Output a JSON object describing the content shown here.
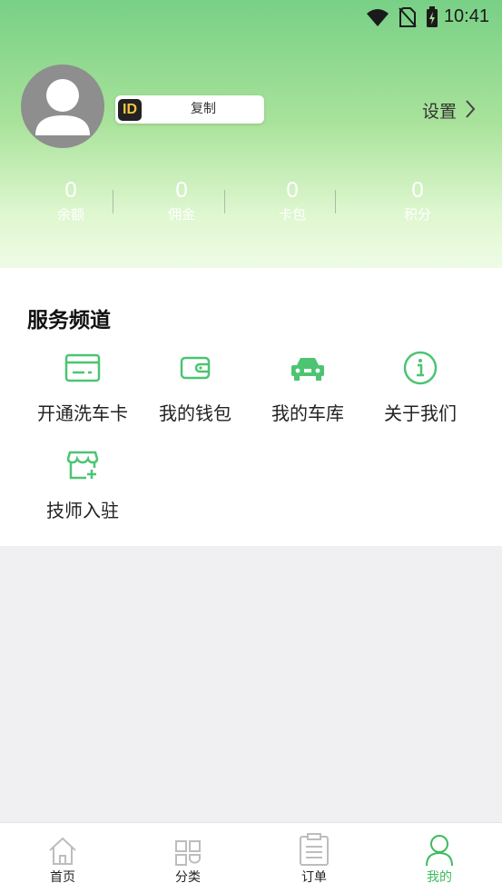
{
  "status_bar": {
    "time": "10:41"
  },
  "profile": {
    "id_badge": "ID",
    "copy_label": "复制"
  },
  "settings": {
    "label": "设置"
  },
  "stats": [
    {
      "value": "0",
      "label": "余额"
    },
    {
      "value": "0",
      "label": "佣金"
    },
    {
      "value": "0",
      "label": "卡包"
    },
    {
      "value": "0",
      "label": "积分"
    }
  ],
  "service": {
    "title": "服务频道",
    "items": [
      {
        "label": "开通洗车卡",
        "icon": "card-icon"
      },
      {
        "label": "我的钱包",
        "icon": "wallet-icon"
      },
      {
        "label": "我的车库",
        "icon": "car-icon"
      },
      {
        "label": "关于我们",
        "icon": "info-icon"
      },
      {
        "label": "技师入驻",
        "icon": "store-icon"
      }
    ]
  },
  "tabbar": {
    "items": [
      {
        "label": "首页",
        "icon": "home-icon"
      },
      {
        "label": "分类",
        "icon": "grid-icon"
      },
      {
        "label": "订单",
        "icon": "clipboard-icon"
      },
      {
        "label": "我的",
        "icon": "user-icon",
        "active": true
      }
    ]
  },
  "colors": {
    "accent": "#3dbb5e",
    "header_top": "#78d086",
    "header_bottom": "#eefbe6"
  }
}
